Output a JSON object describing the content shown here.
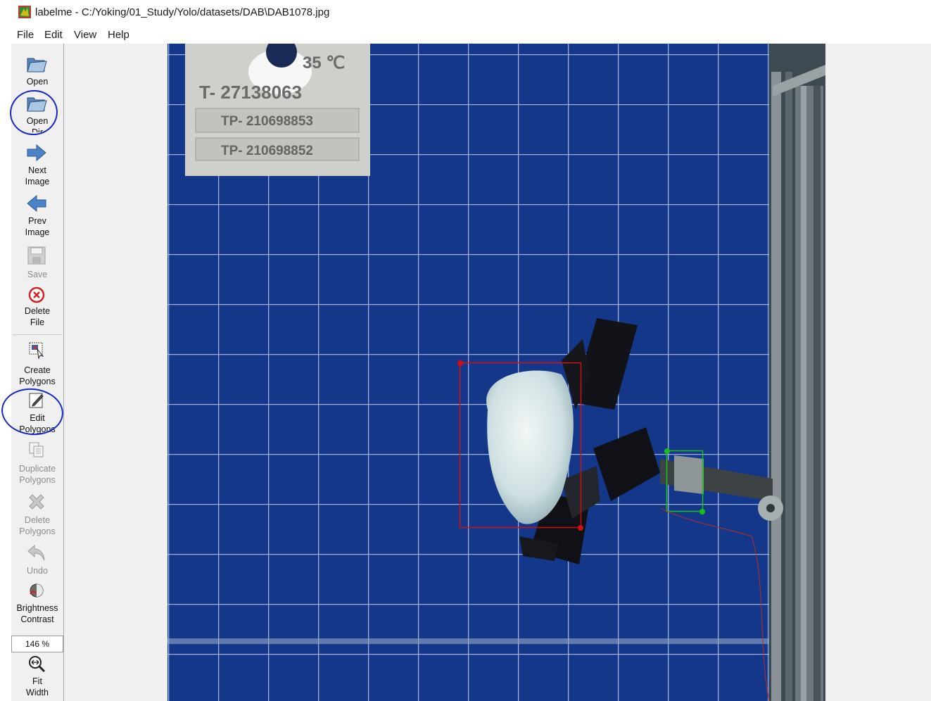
{
  "window": {
    "app_name": "labelme",
    "title": "labelme - C:/Yoking/01_Study/Yolo/datasets/DAB\\DAB1078.jpg"
  },
  "menu": [
    "File",
    "Edit",
    "View",
    "Help"
  ],
  "toolbar": {
    "open": {
      "label": "Open",
      "icon": "open-folder-icon"
    },
    "open_dir": {
      "label": "Open\nDir",
      "icon": "open-folder-icon"
    },
    "next_image": {
      "label": "Next\nImage",
      "icon": "arrow-right-icon"
    },
    "prev_image": {
      "label": "Prev\nImage",
      "icon": "arrow-left-icon"
    },
    "save": {
      "label": "Save",
      "icon": "save-icon",
      "enabled": false
    },
    "delete_file": {
      "label": "Delete\nFile",
      "icon": "delete-circle-icon"
    },
    "create_polygons": {
      "label": "Create\nPolygons",
      "icon": "create-polygon-icon"
    },
    "edit_polygons": {
      "label": "Edit\nPolygons",
      "icon": "edit-icon"
    },
    "duplicate_polygons": {
      "label": "Duplicate\nPolygons",
      "icon": "duplicate-icon",
      "enabled": false
    },
    "delete_polygons": {
      "label": "Delete\nPolygons",
      "icon": "delete-x-icon",
      "enabled": false
    },
    "undo": {
      "label": "Undo",
      "icon": "undo-icon",
      "enabled": false
    },
    "brightness_contrast": {
      "label": "Brightness\nContrast",
      "icon": "brightness-contrast-icon"
    },
    "zoom_value": "146 %",
    "fit_width": {
      "label": "Fit\nWidth",
      "icon": "fit-width-icon"
    }
  },
  "image": {
    "sign_lines": [
      "35 ℃",
      "T- 27138063",
      "TP- 210698853",
      "TP- 210698852"
    ],
    "shapes": [
      {
        "name": "airbag-box",
        "color": "#d01010"
      },
      {
        "name": "bracket-box",
        "color": "#18c018"
      }
    ]
  },
  "colors": {
    "toolbar_bg": "#f0f0f0",
    "canvas_bg": "#f0f0f0",
    "grid_bg": "#14378a",
    "annotation_circle": "#1528c8"
  }
}
